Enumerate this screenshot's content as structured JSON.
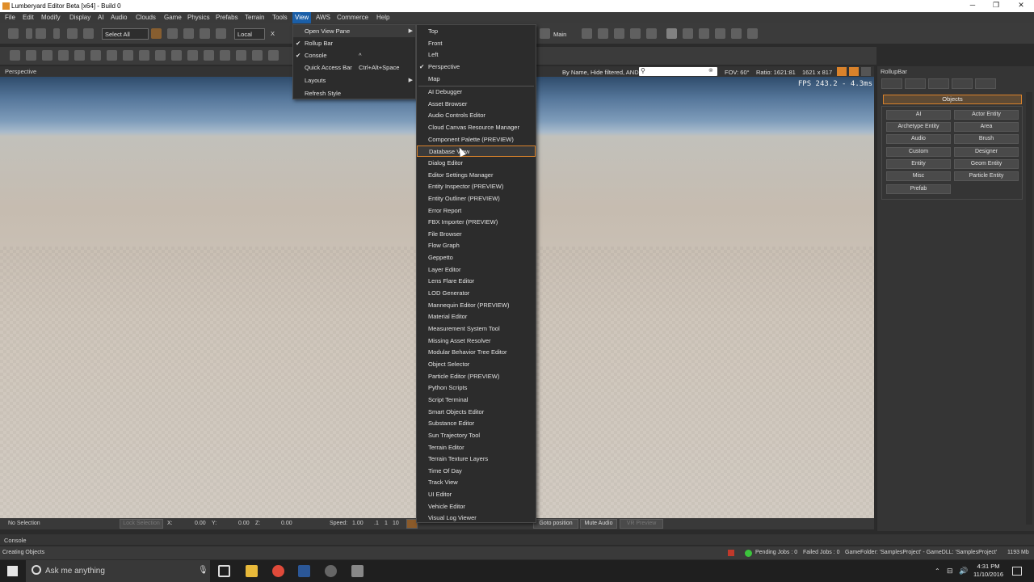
{
  "window": {
    "title": "Lumberyard Editor Beta [x64] - Build 0",
    "minimize": "─",
    "maximize": "❐",
    "close": "✕"
  },
  "menubar": [
    "File",
    "Edit",
    "Modify",
    "Display",
    "AI",
    "Audio",
    "Clouds",
    "Game",
    "Physics",
    "Prefabs",
    "Terrain",
    "Tools",
    "View",
    "AWS",
    "Commerce",
    "Help"
  ],
  "toolbar": {
    "select_all": "Select All",
    "coord_system": "Local",
    "axis_x": "X",
    "main_layer": "Main"
  },
  "viewport": {
    "name": "Perspective",
    "filter": "By Name, Hide filtered, AND",
    "fov": "FOV: 60°",
    "ratio": "Ratio: 1621:81",
    "resolution": "1621 x 817",
    "fps": "FPS 243.2 - 4.3ms"
  },
  "view_menu": [
    {
      "label": "Open View Pane",
      "has_submenu": true
    },
    {
      "label": "Rollup Bar",
      "checked": true
    },
    {
      "label": "Console",
      "checked": true,
      "shortcut": "^"
    },
    {
      "label": "Quick Access Bar",
      "shortcut": "Ctrl+Alt+Space"
    },
    {
      "label": "Layouts",
      "has_submenu": true
    },
    {
      "label": "Refresh Style"
    }
  ],
  "view_panes_group1": [
    {
      "label": "Top"
    },
    {
      "label": "Front"
    },
    {
      "label": "Left"
    },
    {
      "label": "Perspective",
      "checked": true
    },
    {
      "label": "Map"
    }
  ],
  "view_panes_group2": [
    "AI Debugger",
    "Asset Browser",
    "Audio Controls Editor",
    "Cloud Canvas Resource Manager",
    "Component Palette (PREVIEW)",
    "Database View",
    "Dialog Editor",
    "Editor Settings Manager",
    "Entity Inspector (PREVIEW)",
    "Entity Outliner (PREVIEW)",
    "Error Report",
    "FBX Importer (PREVIEW)",
    "File Browser",
    "Flow Graph",
    "Geppetto",
    "Layer Editor",
    "Lens Flare Editor",
    "LOD Generator",
    "Mannequin Editor (PREVIEW)",
    "Material Editor",
    "Measurement System Tool",
    "Missing Asset Resolver",
    "Modular Behavior Tree Editor",
    "Object Selector",
    "Particle Editor (PREVIEW)",
    "Python Scripts",
    "Script Terminal",
    "Smart Objects Editor",
    "Substance Editor",
    "Sun Trajectory Tool",
    "Terrain Editor",
    "Terrain Texture Layers",
    "Time Of Day",
    "Track View",
    "UI Editor",
    "Vehicle Editor",
    "Visual Log Viewer"
  ],
  "highlighted_pane": "Database View",
  "rollup": {
    "title": "RollupBar",
    "section": "Objects",
    "buttons": [
      "AI",
      "Actor Entity",
      "Archetype Entity",
      "Area",
      "Audio",
      "Brush",
      "Custom",
      "Designer",
      "Entity",
      "Geom Entity",
      "Misc",
      "Particle Entity",
      "Prefab"
    ]
  },
  "vp_status": {
    "selection": "No Selection",
    "lock_selection": "Lock Selection",
    "x_label": "X:",
    "x_value": "0.00",
    "y_label": "Y:",
    "y_value": "0.00",
    "z_label": "Z:",
    "z_value": "0.00",
    "speed_label": "Speed:",
    "speed_value": "1.00",
    "speed_opt1": ".1",
    "speed_opt2": "1",
    "speed_opt3": "10",
    "goto_position": "Goto position",
    "mute_audio": "Mute Audio",
    "vr_preview": "VR Preview"
  },
  "console": {
    "title": "Console",
    "message": "Creating Objects"
  },
  "status": {
    "pending_jobs": "Pending Jobs : 0",
    "failed_jobs": "Failed Jobs : 0",
    "game_folder": "GameFolder: 'SamplesProject' - GameDLL: 'SamplesProject'",
    "memory": "1193 Mb"
  },
  "taskbar": {
    "search_placeholder": "Ask me anything",
    "time": "4:31 PM",
    "date": "11/10/2016"
  },
  "colors": {
    "accent": "#d9822b",
    "menu_highlight": "#1b5fa8",
    "panel": "#3a3a3a",
    "sky_top": "#2f4c6c",
    "ground": "#cfc6bb"
  }
}
